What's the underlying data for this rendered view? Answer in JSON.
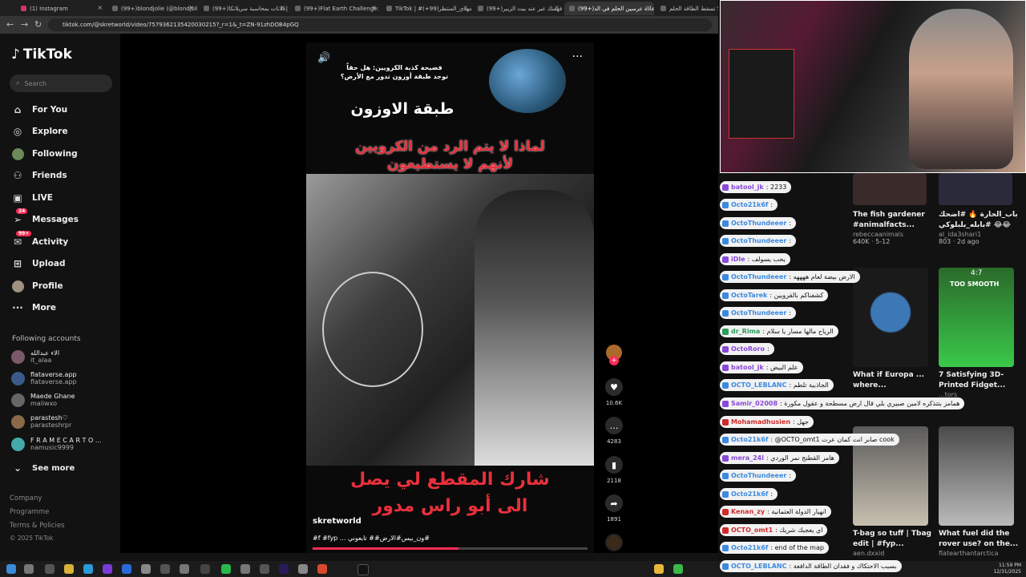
{
  "browser": {
    "tabs": [
      {
        "label": "(1) Instagram"
      },
      {
        "label": "(99+)blondjolie (@blondjolie)"
      },
      {
        "label": "(99+)إعلانات بمحاسبة سريلانكا"
      },
      {
        "label": "(99+)Flat Earth Challenge: Do"
      },
      {
        "label": "TikTok | #المهدي_المنتظر(99+)"
      },
      {
        "label": "(99+)فهمتك غير عند بيت الزبير"
      },
      {
        "label": "(99+)عادة عرسين الحلم في الد..."
      },
      {
        "label": "لا تسقط الطاقة الحلم"
      }
    ],
    "url": "tiktok.com/@skretworld/video/7579362135420030215?_r=1&_t=ZN-91zhDOB4pGQ"
  },
  "sidebar": {
    "logo": "TikTok",
    "search_placeholder": "Search",
    "nav": [
      {
        "label": "For You",
        "icon": "home-icon"
      },
      {
        "label": "Explore",
        "icon": "compass-icon"
      },
      {
        "label": "Following",
        "icon": "following-avatar"
      },
      {
        "label": "Friends",
        "icon": "friends-icon"
      },
      {
        "label": "LIVE",
        "icon": "live-icon"
      },
      {
        "label": "Messages",
        "icon": "messages-icon",
        "badge": "24"
      },
      {
        "label": "Activity",
        "icon": "activity-icon",
        "badge": "99+"
      },
      {
        "label": "Upload",
        "icon": "upload-icon"
      },
      {
        "label": "Profile",
        "icon": "profile-avatar"
      },
      {
        "label": "More",
        "icon": "more-icon"
      }
    ],
    "following_title": "Following accounts",
    "following": [
      {
        "name": "الاء عبدالله",
        "handle": "it_alaa"
      },
      {
        "name": "flataverse.app",
        "handle": "flataverse.app"
      },
      {
        "name": "Maede Ghane",
        "handle": "maiiwxo"
      },
      {
        "name": "parastesh♡",
        "handle": "parasteshrpr"
      },
      {
        "name": "F R A M E C A R T O ...",
        "handle": "namusic9999"
      }
    ],
    "see_more": "See more",
    "footer": [
      "Company",
      "Programme",
      "Terms & Policies",
      "© 2025 TikTok"
    ]
  },
  "video": {
    "top_text_small": "فضيحة كذبة الكرويين: هل حقاً توجد طبقة أوزون تدور مع الأرض؟",
    "ozone_label": "طبقة الاوزون",
    "red_line1": "لماذا لا يتم الرد من الكرويين",
    "red_line2": "لأنهم لا يستطيعون",
    "bottom_line1": "شارك المقطع لي يصل",
    "bottom_line2": "الى أبو راس مدور",
    "author": "skretworld",
    "caption": "#f #fyp ... ون_بيس#الارض## تابعوني#",
    "counts": {
      "likes": "10.6K",
      "comments": "4283",
      "saves": "2118",
      "shares": "1891"
    }
  },
  "chat": [
    {
      "user": "batool_jk",
      "text": ": 2233",
      "color": "purple"
    },
    {
      "user": "Octo21k6f",
      "text": ":",
      "color": "blue"
    },
    {
      "user": "OctoThundeeer",
      "text": ":",
      "color": "blue"
    },
    {
      "user": "OctoThundeeer",
      "text": ":",
      "color": "blue"
    },
    {
      "user": "iDle",
      "text": ": يحب يسولف",
      "color": "purple"
    },
    {
      "user": "OctoThundeeer",
      "text": ": الارض بيضة لعام ههههه",
      "color": "blue"
    },
    {
      "user": "OctoTarek",
      "text": ": كشفناكم بالقرويين",
      "color": "blue"
    },
    {
      "user": "OctoThundeeer",
      "text": ":",
      "color": "blue"
    },
    {
      "user": "dr_Rima",
      "text": ": الرياح مالها مسار يا سلام",
      "color": "green"
    },
    {
      "user": "OctoRoro",
      "text": ":",
      "color": "purple"
    },
    {
      "user": "batool_jk",
      "text": ": علم البيض",
      "color": "purple"
    },
    {
      "user": "OCTO_LEBLANC",
      "text": ": الجاذبية تلطم",
      "color": "blue"
    },
    {
      "user": "Samir_02008",
      "text": ": همامز بتتذكره لامين صبيري بلي قال ارض مسطحة و عقول مكورة",
      "color": "purple"
    },
    {
      "user": "Mohamadhusien",
      "text": ": جهل",
      "color": "red"
    },
    {
      "user": "Octo21k6f",
      "text": ": @OCTO_omt1 صابر انت كمان عرت cook",
      "color": "blue"
    },
    {
      "user": "mera_24l",
      "text": ": هامز القطنج نمر الوردي",
      "color": "purple"
    },
    {
      "user": "OctoThundeeer",
      "text": ":",
      "color": "blue"
    },
    {
      "user": "Octo21k6f",
      "text": ":",
      "color": "blue"
    },
    {
      "user": "Kenan_zy",
      "text": ": انهيار الدولة العثمانية",
      "color": "red"
    },
    {
      "user": "OCTO_omt1",
      "text": ": اي يعجبك شريك",
      "color": "red"
    },
    {
      "user": "Octo21k6f",
      "text": ": end of the map",
      "color": "blue"
    },
    {
      "user": "OCTO_LEBLANC",
      "text": ": بسبب الاحتكاك و فقدان الطاقة الدافعة",
      "color": "blue"
    }
  ],
  "suggestions": [
    {
      "title": "The fish gardener #animalfacts...",
      "author": "rebeccaanimals",
      "meta": "640K · 5-12"
    },
    {
      "title": "باب_الحارة 🔥 #اضحك #بابله_بلبلوكي 😂😂",
      "author": "al_ida3shari1",
      "meta": "803 · 2d ago"
    },
    {
      "title": "What if Europa ... where...",
      "author": "",
      "meta": ""
    },
    {
      "title": "7 Satisfying 3D-Printed Fidget...",
      "author": "...tors",
      "meta": "11-30"
    },
    {
      "title": "T-bag so tuff | Tbag edit | #fyp...",
      "author": "aen.dxxid",
      "meta": ""
    },
    {
      "title": "What fuel did the rover use? on the...",
      "author": "flatearthantarctica",
      "meta": ""
    }
  ],
  "suggestion_badges": {
    "fidget": "4:7",
    "fidget_caption": "TOO SMOOTH"
  },
  "clock": {
    "time": "11:59 PM",
    "date": "12/31/2025"
  },
  "colors": {
    "tiktok_red": "#fe2c55",
    "background": "#121212",
    "chat_bg": "#f2f2f2"
  }
}
